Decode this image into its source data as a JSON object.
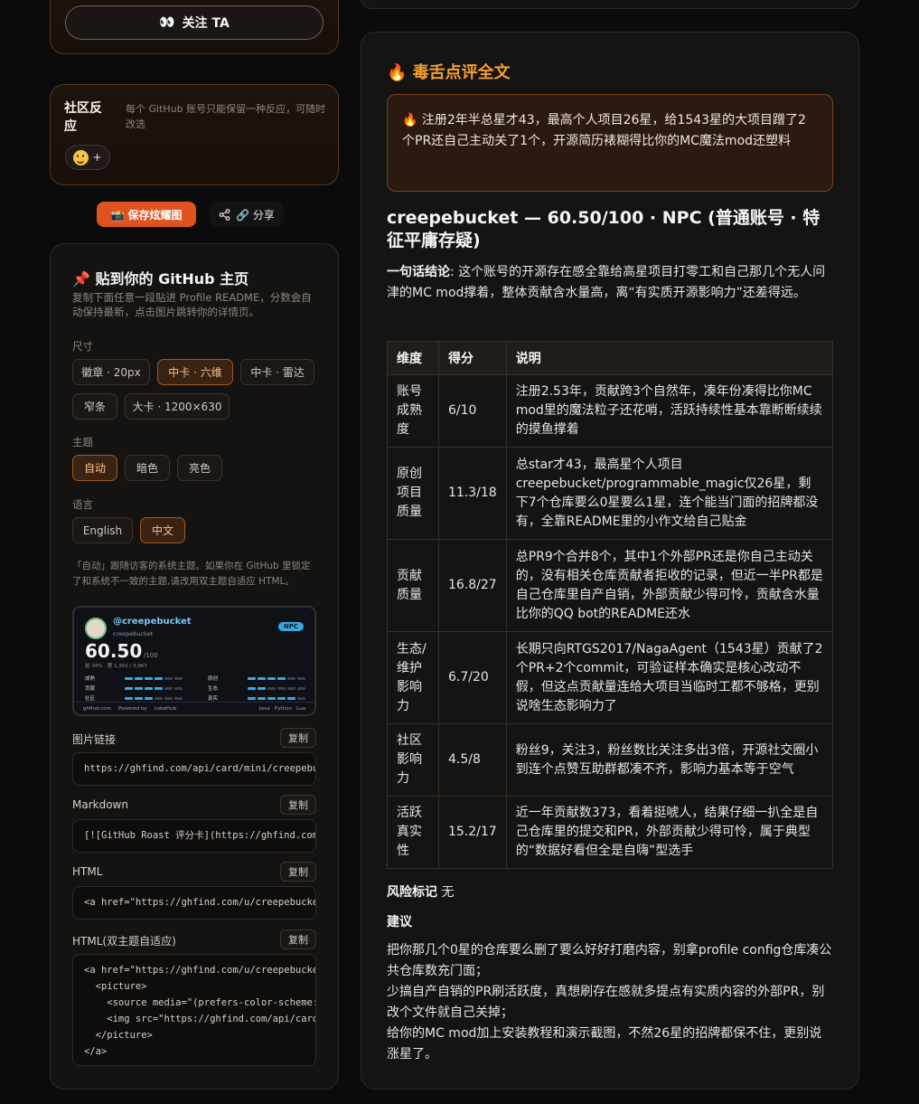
{
  "follow": {
    "icon": "👀",
    "label": "关注 TA"
  },
  "reaction": {
    "title": "社区反应",
    "hint": "每个 GitHub 账号只能保留一种反应，可随时改选",
    "add_label": "+"
  },
  "actions": {
    "save_label": "📸 保存炫耀图",
    "share_label": "🔗 分享"
  },
  "embed": {
    "title": "📌 贴到你的 GitHub 主页",
    "desc": "复制下面任意一段贴进 Profile README，分数会自动保持最新，点击图片跳转你的详情页。",
    "size_label": "尺寸",
    "sizes": [
      "徽章 · 20px",
      "中卡 · 六维",
      "中卡 · 雷达",
      "窄条",
      "大卡 · 1200×630"
    ],
    "size_selected": "中卡 · 六维",
    "theme_label": "主题",
    "themes": [
      "自动",
      "暗色",
      "亮色"
    ],
    "theme_selected": "自动",
    "lang_label": "语言",
    "langs": [
      "English",
      "中文"
    ],
    "lang_selected": "中文",
    "theme_note": "「自动」跟随访客的系统主题。如果你在 GitHub 里锁定了和系统不一致的主题,请改用双主题自适应 HTML。",
    "card": {
      "handle": "@creepebucket",
      "sub": "creepebucket",
      "badge": "NPC",
      "score": "60.50",
      "max": "/100",
      "rank": "前 34% · 第 1,350 / 3,967",
      "dims_left": [
        {
          "label": "成熟",
          "level": 4
        },
        {
          "label": "贡献",
          "level": 4
        },
        {
          "label": "社区",
          "level": 3
        }
      ],
      "dims_right": [
        {
          "label": "原创",
          "level": 4
        },
        {
          "label": "生态",
          "level": 2
        },
        {
          "label": "真实",
          "level": 5
        }
      ],
      "footer_site": "ghfind.com",
      "footer_powered": "Powered by",
      "footer_brand": "LobeHub",
      "footer_langs": "Java · Python · Lua"
    },
    "copy_label": "复制",
    "fields": {
      "image_label": "图片链接",
      "image_value": "https://ghfind.com/api/card/mini/creepebucket",
      "markdown_label": "Markdown",
      "markdown_value": "[![GitHub Roast 评分卡](https://ghfind.com/api/card/mini/creepebucket)](https://ghfind.com/u/creepebucket)",
      "html_label": "HTML",
      "html_value": "<a href=\"https://ghfind.com/u/creepebucket\"><img src=\"https://ghfind.com/api/card/mini/creepebucket\"></a>",
      "html_dual_label": "HTML(双主题自适应)",
      "html_dual_value": "<a href=\"https://ghfind.com/u/creepebucket\">\n  <picture>\n    <source media=\"(prefers-color-scheme: dark)\">\n    <img src=\"https://ghfind.com/api/card/mini/creepebucket\">\n  </picture>\n</a>"
    }
  },
  "roast": {
    "heading": "🔥 毒舌点评全文",
    "quote": "🔥 注册2年半总星才43，最高个人项目26星，给1543星的大项目蹭了2个PR还自己主动关了1个，开源简历裱糊得比你的MC魔法mod还塑料",
    "title": "creepebucket — 60.50/100 · NPC (普通账号 · 特征平庸存疑)",
    "verdict_label": "一句话结论",
    "verdict_text": ": 这个账号的开源存在感全靠给高星项目打零工和自己那几个无人问津的MC mod撑着，整体贡献含水量高，离“有实质开源影响力”还差得远。",
    "table_headers": [
      "维度",
      "得分",
      "说明"
    ],
    "table_rows": [
      {
        "dim": "账号成熟度",
        "score": "6/10",
        "note": "注册2.53年，贡献跨3个自然年，凑年份凑得比你MC mod里的魔法粒子还花哨，活跃持续性基本靠断断续续的摸鱼撑着"
      },
      {
        "dim": "原创项目质量",
        "score": "11.3/18",
        "note": "总star才43，最高星个人项目creepebucket/programmable_magic仅26星，剩下7个仓库要么0星要么1星，连个能当门面的招牌都没有，全靠README里的小作文给自己贴金"
      },
      {
        "dim": "贡献质量",
        "score": "16.8/27",
        "note": "总PR9个合并8个，其中1个外部PR还是你自己主动关的，没有相关仓库贡献者拒收的记录，但近一半PR都是自己仓库里自产自销，外部贡献少得可怜，贡献含水量比你的QQ bot的README还水"
      },
      {
        "dim": "生态/维护影响力",
        "score": "6.7/20",
        "note": "长期只向RTGS2017/NagaAgent（1543星）贡献了2个PR+2个commit，可验证样本确实是核心改动不假，但这点贡献量连给大项目当临时工都不够格，更别说啥生态影响力了"
      },
      {
        "dim": "社区影响力",
        "score": "4.5/8",
        "note": "粉丝9，关注3，粉丝数比关注多出3倍，开源社交圈小到连个点赞互助群都凑不齐，影响力基本等于空气"
      },
      {
        "dim": "活跃真实性",
        "score": "15.2/17",
        "note": "近一年贡献数373，看着挺唬人，结果仔细一扒全是自己仓库里的提交和PR，外部贡献少得可怜，属于典型的“数据好看但全是自嗨”型选手"
      }
    ],
    "risk_label": "风险标记",
    "risk_value": "无",
    "suggest_title": "建议",
    "suggestions": [
      "把你那几个0星的仓库要么删了要么好好打磨内容，别拿profile config仓库凑公共仓库数充门面；",
      "少搞自产自销的PR刷活跃度，真想刷存在感就多提点有实质内容的外部PR，别改个文件就自己关掉；",
      "给你的MC mod加上安装教程和演示截图，不然26星的招牌都保不住，更别说涨星了。"
    ]
  }
}
